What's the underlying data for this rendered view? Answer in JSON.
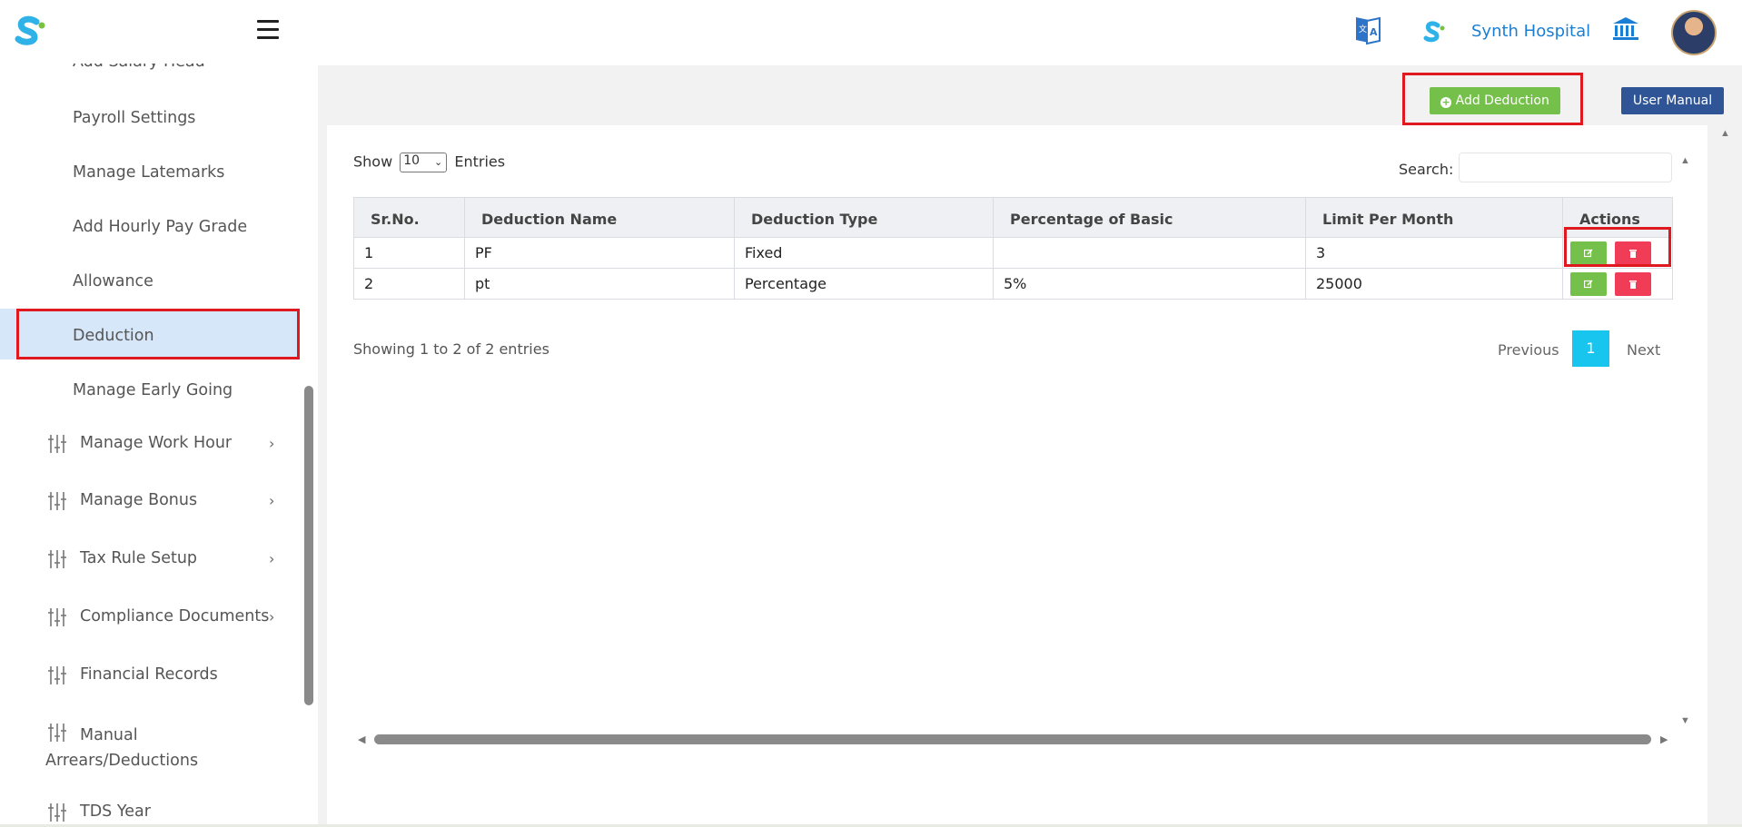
{
  "header": {
    "hospital_name": "Synth Hospital"
  },
  "sidebar": {
    "items": [
      {
        "label": "Add Salary Head"
      },
      {
        "label": "Payroll Settings"
      },
      {
        "label": "Manage Latemarks"
      },
      {
        "label": "Add Hourly Pay Grade"
      },
      {
        "label": "Allowance"
      },
      {
        "label": "Deduction",
        "active": true
      },
      {
        "label": "Manage Early Going"
      }
    ],
    "groups": [
      {
        "label": "Manage Work Hour"
      },
      {
        "label": "Manage Bonus"
      },
      {
        "label": "Tax Rule Setup"
      },
      {
        "label": "Compliance Documents"
      },
      {
        "label": "Financial Records"
      },
      {
        "label_line1": "Manual",
        "label_line2": "Arrears/Deductions"
      },
      {
        "label": "TDS Year"
      }
    ]
  },
  "toolbar": {
    "add_label": "Add Deduction",
    "manual_label": "User Manual"
  },
  "table_controls": {
    "show_label": "Show",
    "page_size": "10",
    "entries_label": "Entries",
    "search_label": "Search:"
  },
  "table": {
    "headers": [
      "Sr.No.",
      "Deduction Name",
      "Deduction Type",
      "Percentage of Basic",
      "Limit Per Month",
      "Actions"
    ],
    "rows": [
      [
        "1",
        "PF",
        "Fixed",
        "",
        "3"
      ],
      [
        "2",
        "pt",
        "Percentage",
        "5%",
        "25000"
      ]
    ]
  },
  "footer": {
    "showing_text": "Showing 1 to 2 of 2 entries",
    "prev_label": "Previous",
    "current_page": "1",
    "next_label": "Next"
  },
  "colors": {
    "primary_green": "#75c04a",
    "delete_red": "#f13c58",
    "manual_blue": "#2f5597",
    "page_active": "#17c5ee",
    "highlight_red": "#e0181f"
  }
}
